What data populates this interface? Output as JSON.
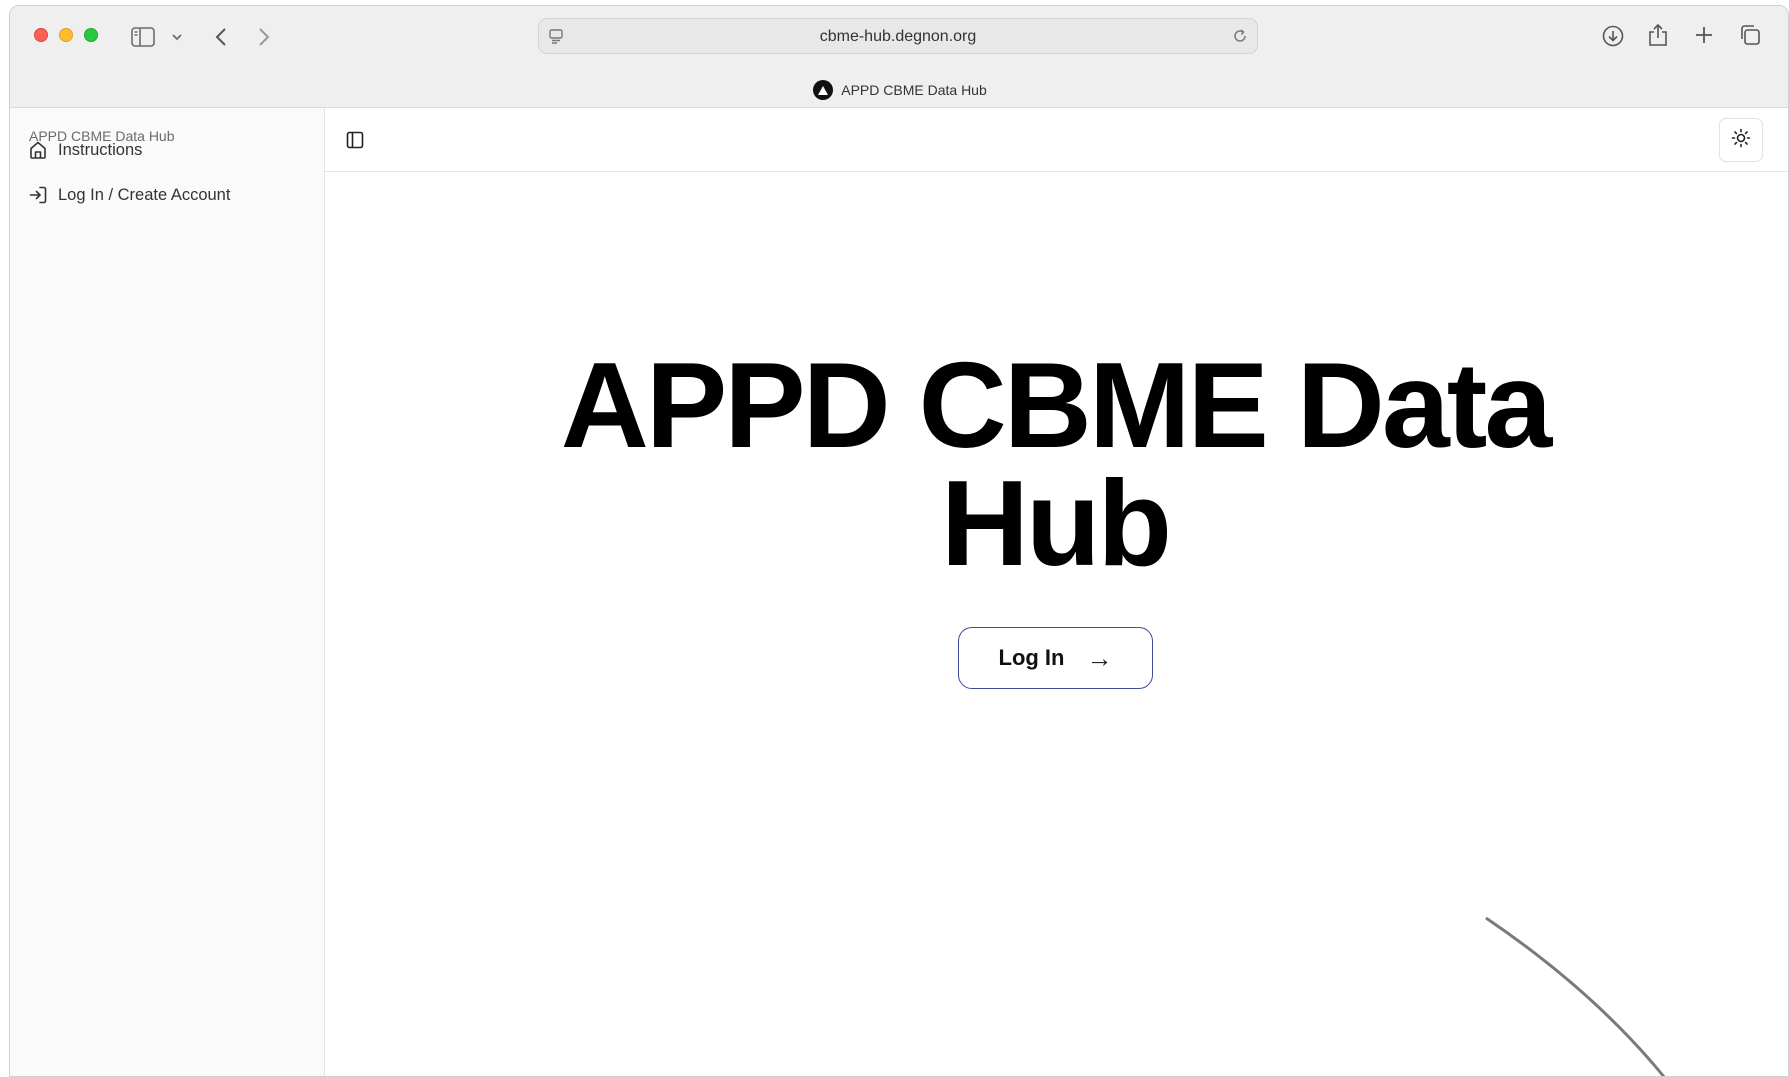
{
  "browser": {
    "url": "cbme-hub.degnon.org",
    "tab_title": "APPD CBME Data Hub"
  },
  "sidebar": {
    "title": "APPD CBME Data Hub",
    "items": [
      {
        "label": "Instructions",
        "icon": "home-icon"
      },
      {
        "label": "Log In / Create Account",
        "icon": "login-icon"
      }
    ]
  },
  "main": {
    "title": "APPD CBME Data Hub",
    "login_button": "Log In",
    "login_arrow": "→"
  }
}
